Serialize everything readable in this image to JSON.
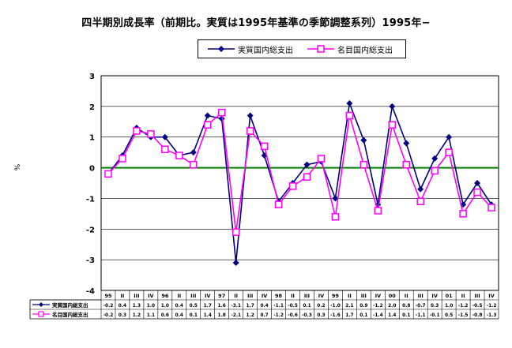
{
  "title": "四半期別成長率（前期比。実質は1995年基準の季節調整系列）1995年−",
  "y_unit": "%",
  "legend": [
    {
      "label": "実質国内総支出",
      "color": "#000080",
      "marker": "diamond"
    },
    {
      "label": "名目国内総支出",
      "color": "#ff00ff",
      "marker": "square"
    }
  ],
  "chart_data": {
    "type": "line",
    "ylim": [
      -4,
      3
    ],
    "yticks": [
      3,
      2,
      1,
      0,
      -1,
      -2,
      -3,
      -4
    ],
    "grid": true,
    "zero_line_color": "#008000",
    "legend_position": "top",
    "categories": [
      "95",
      "II",
      "III",
      "IV",
      "96",
      "II",
      "III",
      "IV",
      "97",
      "II",
      "III",
      "IV",
      "98",
      "II",
      "III",
      "IV",
      "99",
      "II",
      "III",
      "IV",
      "00",
      "II",
      "III",
      "IV",
      "01",
      "II",
      "III",
      "IV"
    ],
    "series": [
      {
        "name": "実質国内総支出",
        "color": "#000080",
        "marker": "diamond",
        "values": [
          -0.2,
          0.4,
          1.3,
          1.0,
          1.0,
          0.4,
          0.5,
          1.7,
          1.6,
          -3.1,
          1.7,
          0.4,
          -1.1,
          -0.5,
          0.1,
          0.2,
          -1.0,
          2.1,
          0.9,
          -1.2,
          2.0,
          0.8,
          -0.7,
          0.3,
          1.0,
          -1.2,
          -0.5,
          -1.2
        ]
      },
      {
        "name": "名目国内総支出",
        "color": "#ff00ff",
        "marker": "square",
        "values": [
          -0.2,
          0.3,
          1.2,
          1.1,
          0.6,
          0.4,
          0.1,
          1.4,
          1.8,
          -2.1,
          1.2,
          0.7,
          -1.2,
          -0.6,
          -0.3,
          0.3,
          -1.6,
          1.7,
          0.1,
          -1.4,
          1.4,
          0.1,
          -1.1,
          -0.1,
          0.5,
          -1.5,
          -0.8,
          -1.3
        ]
      }
    ],
    "table_rows": [
      {
        "label": "実質国内総支出",
        "marker": "diamond",
        "color": "#000080",
        "values": [
          "-0.2",
          "0.4",
          "1.3",
          "1.0",
          "1.0",
          "0.4",
          "0.5",
          "1.7",
          "1.6",
          "-3.1",
          "1.7",
          "0.4",
          "-1.1",
          "-0.5",
          "0.1",
          "0.2",
          "-1.0",
          "2.1",
          "0.9",
          "-1.2",
          "2.0",
          "0.8",
          "-0.7",
          "0.3",
          "1.0",
          "-1.2",
          "-0.5",
          "-1.2"
        ]
      },
      {
        "label": "名目国内総支出",
        "marker": "square",
        "color": "#ff00ff",
        "values": [
          "-0.2",
          "0.3",
          "1.2",
          "1.1",
          "0.6",
          "0.4",
          "0.1",
          "1.4",
          "1.8",
          "-2.1",
          "1.2",
          "0.7",
          "-1.2",
          "-0.6",
          "-0.3",
          "0.3",
          "-1.6",
          "1.7",
          "0.1",
          "-1.4",
          "1.4",
          "0.1",
          "-1.1",
          "-0.1",
          "0.5",
          "-1.5",
          "-0.8",
          "-1.3"
        ]
      }
    ]
  }
}
